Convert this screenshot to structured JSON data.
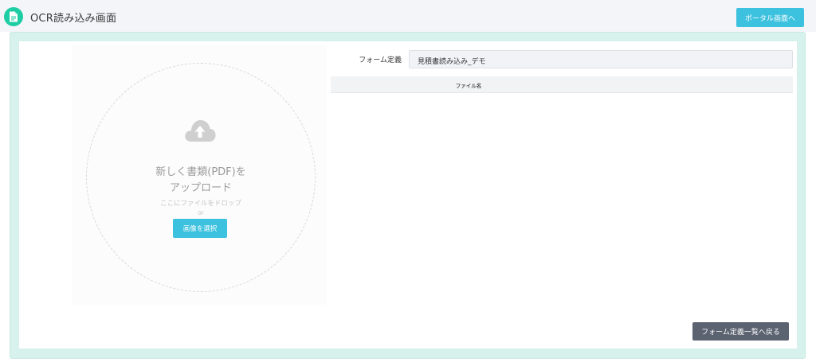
{
  "header": {
    "title": "OCR読み込み画面",
    "app_icon": "document-icon",
    "portal_button_label": "ポータル画面へ"
  },
  "upload": {
    "icon": "cloud-upload-icon",
    "title_line1": "新しく書類(PDF)を",
    "title_line2": "アップロード",
    "drop_hint": "ここにファイルをドロップ",
    "or_text": "or",
    "select_button_label": "画像を選択"
  },
  "form": {
    "label": "フォーム定義",
    "selected_value": "見積書読み込み_デモ"
  },
  "file_table": {
    "columns": [
      "ファイル名"
    ],
    "rows": []
  },
  "footer": {
    "back_button_label": "フォーム定義一覧へ戻る"
  },
  "colors": {
    "accent": "#3cc1de",
    "icon_green": "#1ecda4",
    "frame": "#d7f2ec",
    "dark_button": "#5b6270"
  }
}
